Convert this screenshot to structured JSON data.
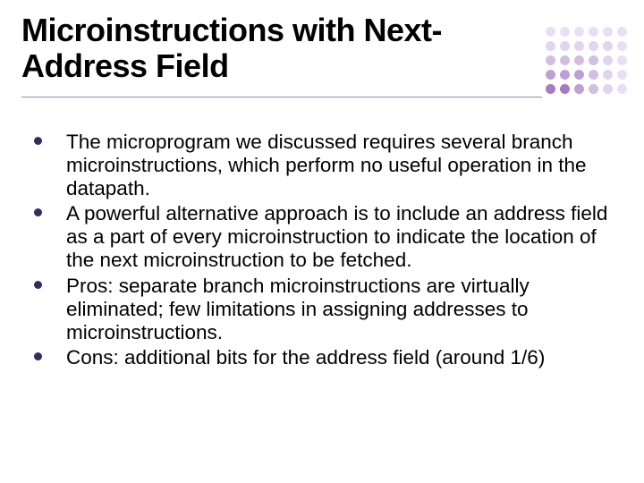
{
  "title": "Microinstructions with Next-Address Field",
  "bullets": [
    "The microprogram we discussed requires several branch microinstructions, which perform no useful operation in the datapath.",
    "A powerful alternative approach is to include an address field as a part of every microinstruction to indicate the location of the next microinstruction to be fetched.",
    "Pros: separate branch microinstructions are virtually eliminated; few limitations in assigning addresses to microinstructions.",
    "Cons: additional bits for the address field (around 1/6)"
  ],
  "dot_colors": [
    [
      "#e9dff2",
      "#e9dff2",
      "#e9dff2",
      "#e9dff2",
      "#e9dff2",
      "#e9dff2"
    ],
    [
      "#e2d3ee",
      "#e2d3ee",
      "#e2d3ee",
      "#e2d3ee",
      "#e2d3ee",
      "#e9dff2"
    ],
    [
      "#d2bde3",
      "#d2bde3",
      "#d2bde3",
      "#d2bde3",
      "#e2d3ee",
      "#e9dff2"
    ],
    [
      "#bfa0d4",
      "#bfa0d4",
      "#bfa0d4",
      "#d2bde3",
      "#e2d3ee",
      "#e9dff2"
    ],
    [
      "#a47dbf",
      "#a47dbf",
      "#bfa0d4",
      "#d2bde3",
      "#e2d3ee",
      "#e9dff2"
    ]
  ]
}
